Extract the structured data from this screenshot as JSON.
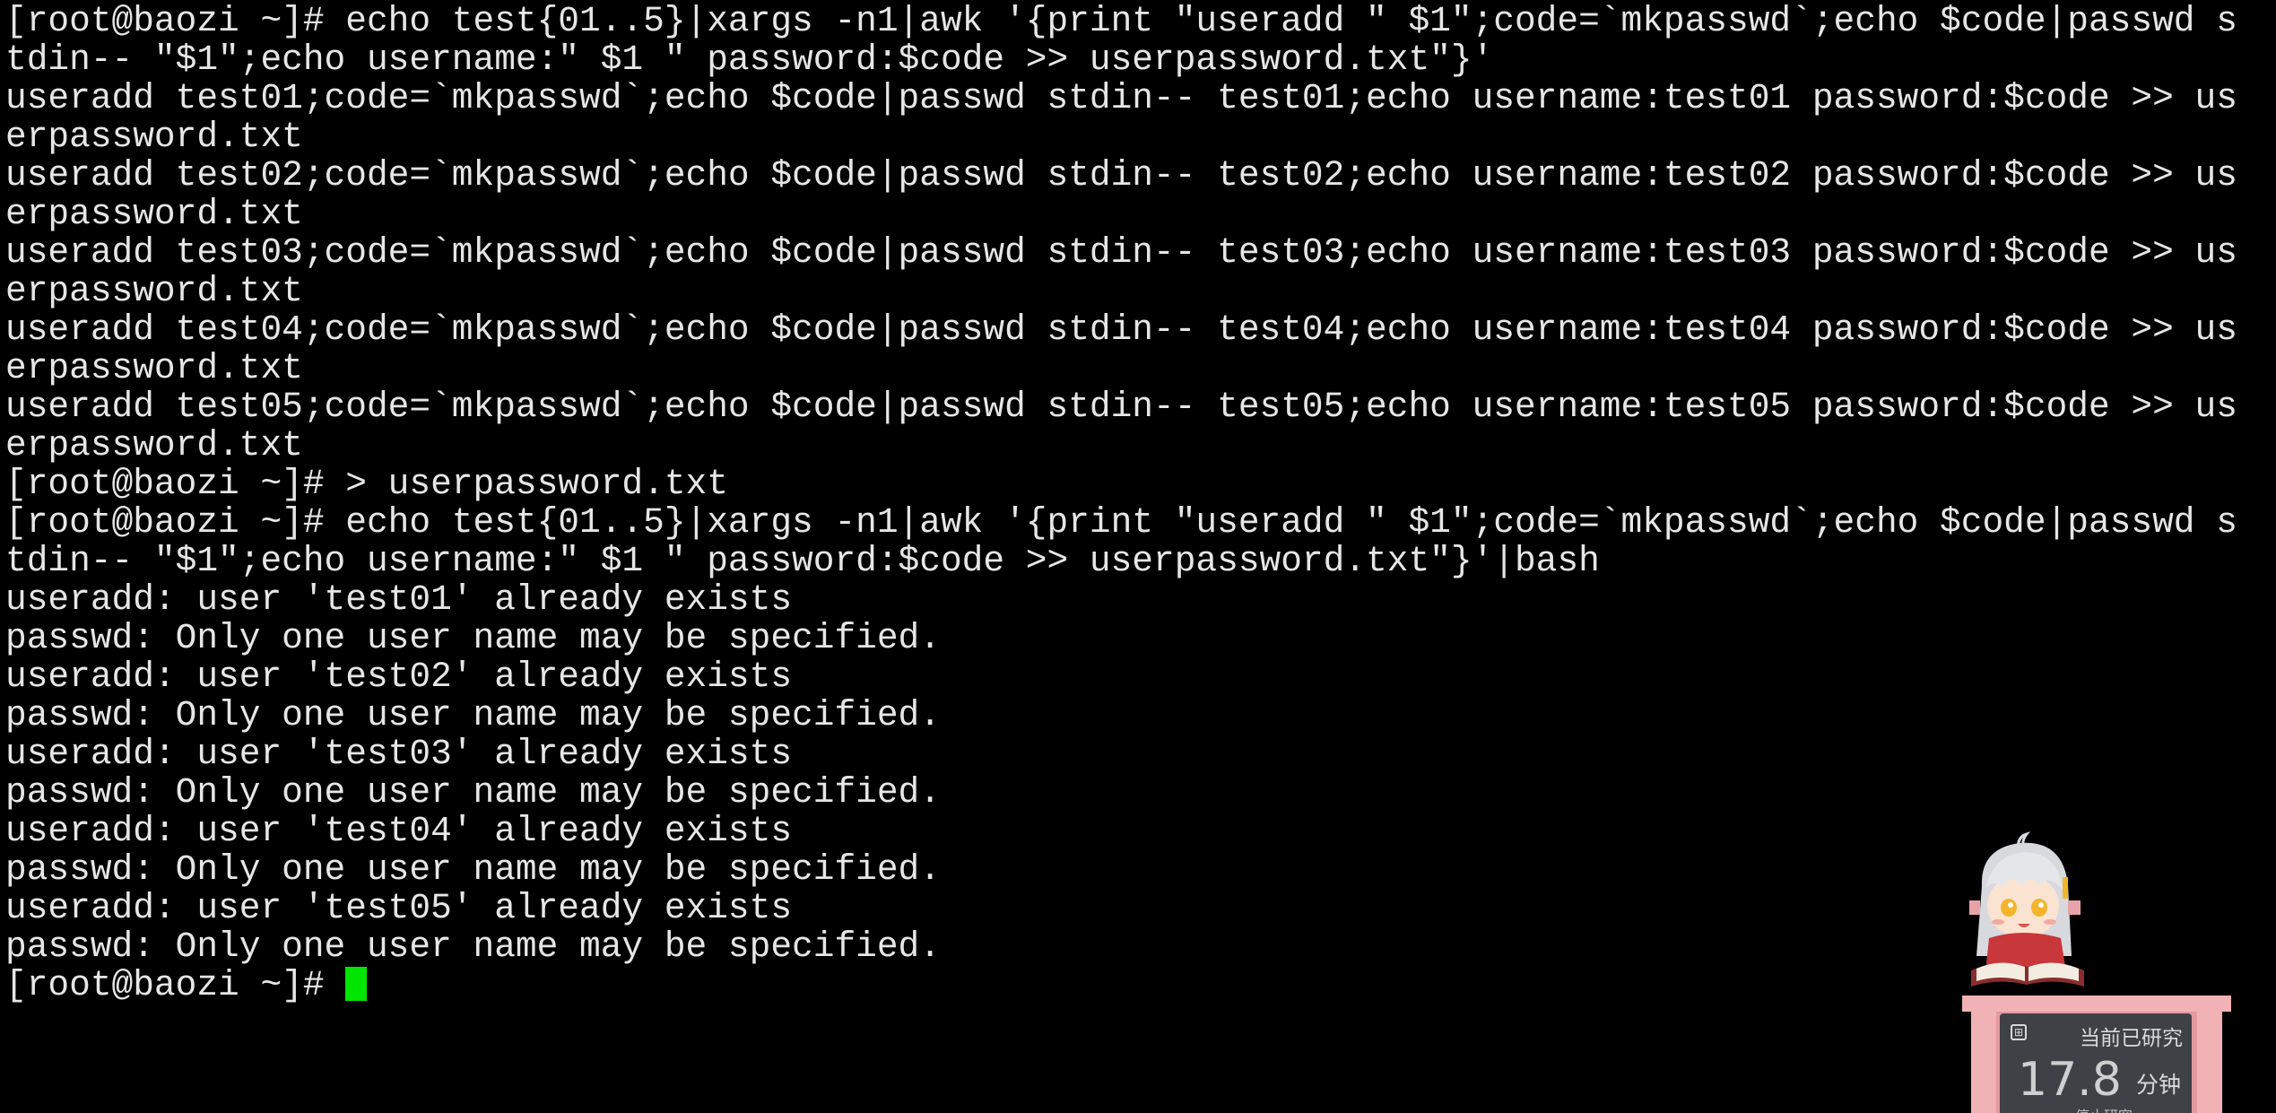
{
  "terminal": {
    "lines": [
      "[root@baozi ~]# echo test{01..5}|xargs -n1|awk '{print \"useradd \" $1\";code=`mkpasswd`;echo $code|passwd s",
      "tdin-- \"$1\";echo username:\" $1 \" password:$code >> userpassword.txt\"}'",
      "useradd test01;code=`mkpasswd`;echo $code|passwd stdin-- test01;echo username:test01 password:$code >> us",
      "erpassword.txt",
      "useradd test02;code=`mkpasswd`;echo $code|passwd stdin-- test02;echo username:test02 password:$code >> us",
      "erpassword.txt",
      "useradd test03;code=`mkpasswd`;echo $code|passwd stdin-- test03;echo username:test03 password:$code >> us",
      "erpassword.txt",
      "useradd test04;code=`mkpasswd`;echo $code|passwd stdin-- test04;echo username:test04 password:$code >> us",
      "erpassword.txt",
      "useradd test05;code=`mkpasswd`;echo $code|passwd stdin-- test05;echo username:test05 password:$code >> us",
      "erpassword.txt",
      "[root@baozi ~]# > userpassword.txt",
      "[root@baozi ~]# echo test{01..5}|xargs -n1|awk '{print \"useradd \" $1\";code=`mkpasswd`;echo $code|passwd s",
      "tdin-- \"$1\";echo username:\" $1 \" password:$code >> userpassword.txt\"}'|bash",
      "useradd: user 'test01' already exists",
      "passwd: Only one user name may be specified.",
      "useradd: user 'test02' already exists",
      "passwd: Only one user name may be specified.",
      "useradd: user 'test03' already exists",
      "passwd: Only one user name may be specified.",
      "useradd: user 'test04' already exists",
      "passwd: Only one user name may be specified.",
      "useradd: user 'test05' already exists",
      "passwd: Only one user name may be specified."
    ],
    "prompt": "[root@baozi ~]# ",
    "colors": {
      "background": "#000000",
      "foreground": "#e6e6e6",
      "cursor": "#00e600"
    }
  },
  "widget": {
    "title": "当前已研究",
    "value": "17.8",
    "unit": "分钟",
    "subtitle": "停止研究",
    "mascot_icon": "anime-girl-reading-book-icon"
  }
}
